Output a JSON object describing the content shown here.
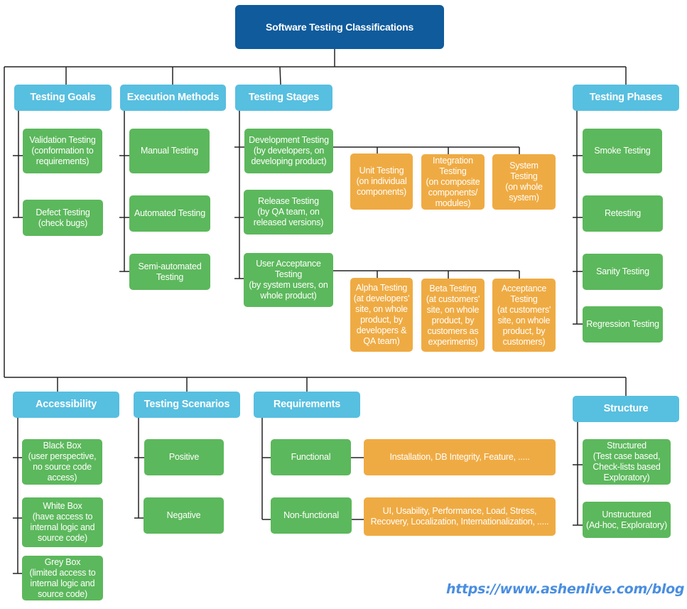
{
  "title": "Software Testing Classifications",
  "colors": {
    "root": "#0f5b9c",
    "category": "#57bfe0",
    "leaf": "#5cb85c",
    "sub": "#efab43",
    "watermark": "#4a8ee0"
  },
  "categories": {
    "testing_goals": {
      "label": "Testing Goals",
      "items": [
        "Validation Testing\n(conformation to\nrequirements)",
        "Defect Testing\n(check bugs)"
      ]
    },
    "execution_methods": {
      "label": "Execution Methods",
      "items": [
        "Manual Testing",
        "Automated Testing",
        "Semi-automated\nTesting"
      ]
    },
    "testing_stages": {
      "label": "Testing Stages",
      "items": [
        {
          "label": "Development Testing\n(by developers, on\ndeveloping product)",
          "children": [
            "Unit Testing\n(on individual\ncomponents)",
            "Integration\nTesting\n(on composite\ncomponents/\nmodules)",
            "System\nTesting\n(on whole\nsystem)"
          ]
        },
        {
          "label": "Release Testing\n(by QA team, on\nreleased versions)",
          "children": []
        },
        {
          "label": "User Acceptance\nTesting\n(by system users, on\nwhole product)",
          "children": [
            "Alpha Testing\n(at developers'\nsite, on whole\nproduct, by\ndevelopers &\nQA team)",
            "Beta Testing\n(at customers'\nsite, on whole\nproduct, by\ncustomers as\nexperiments)",
            "Acceptance\nTesting\n(at customers'\nsite, on whole\nproduct, by\ncustomers)"
          ]
        }
      ]
    },
    "testing_phases": {
      "label": "Testing Phases",
      "items": [
        "Smoke Testing",
        "Retesting",
        "Sanity Testing",
        "Regression Testing"
      ]
    },
    "accessibility": {
      "label": "Accessibility",
      "items": [
        "Black Box\n(user perspective,\nno source code\naccess)",
        "White Box\n(have access to\ninternal logic and\nsource code)",
        "Grey Box\n(limited access to\ninternal logic and\nsource code)"
      ]
    },
    "testing_scenarios": {
      "label": "Testing Scenarios",
      "items": [
        "Positive",
        "Negative"
      ]
    },
    "requirements": {
      "label": "Requirements",
      "items": [
        {
          "label": "Functional",
          "detail": "Installation, DB Integrity, Feature, ....."
        },
        {
          "label": "Non-functional",
          "detail": "UI, Usability, Performance, Load, Stress,\nRecovery, Localization, Internationalization, ....."
        }
      ]
    },
    "structure": {
      "label": "Structure",
      "items": [
        "Structured\n(Test case based,\nCheck-lists based\nExploratory)",
        "Unstructured\n(Ad-hoc, Exploratory)"
      ]
    }
  },
  "watermark": "https://www.ashenlive.com/blog"
}
